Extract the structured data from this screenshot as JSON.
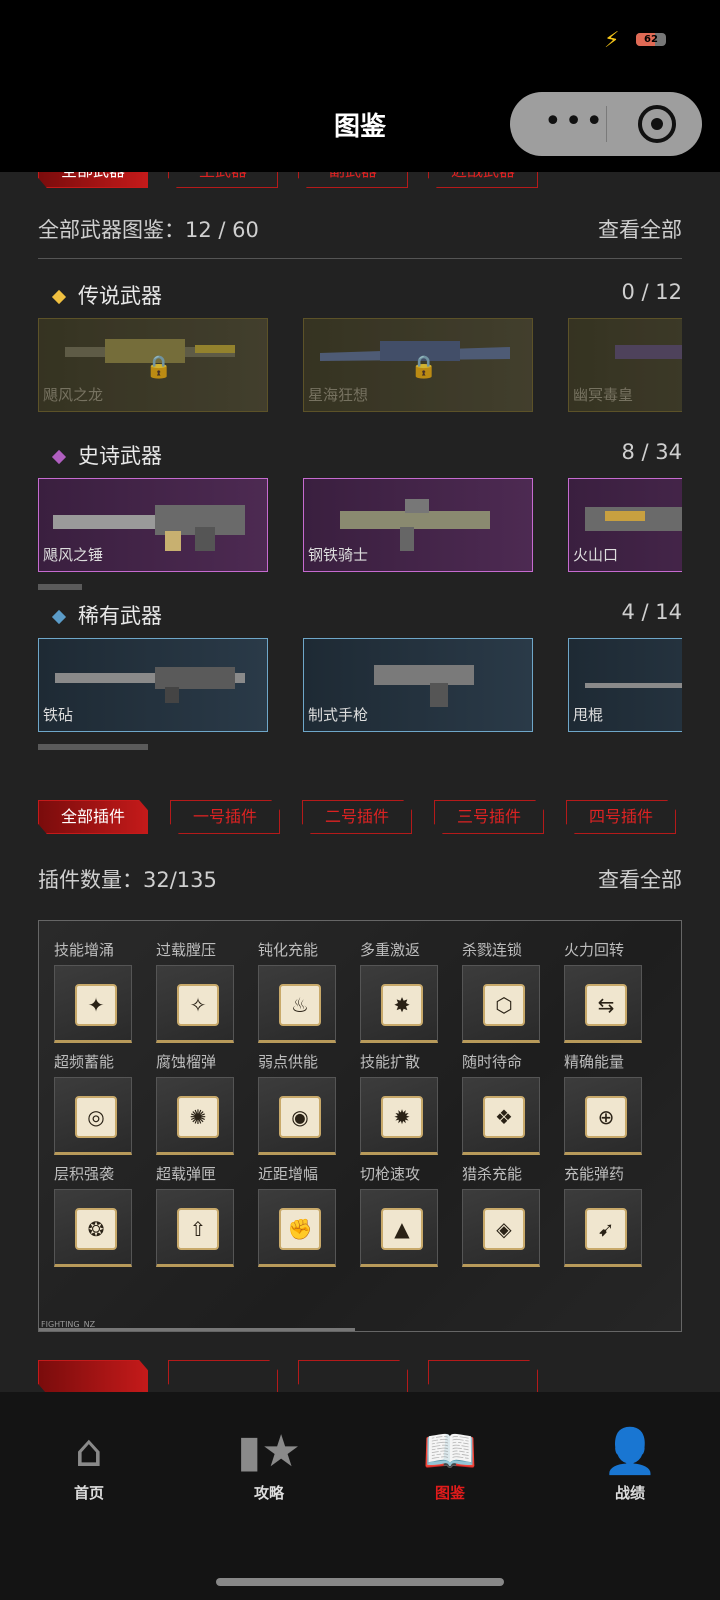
{
  "status": {
    "battery": "62"
  },
  "header": {
    "title": "图鉴"
  },
  "weapon_tabs": [
    "全部武器",
    "主武器",
    "副武器",
    "近战武器"
  ],
  "weapon_summary": {
    "label": "全部武器图鉴：12 / 60",
    "view_all": "查看全部"
  },
  "sections": [
    {
      "title": "传说武器",
      "count": "0 / 12",
      "color": "#f0c040",
      "rarity": "legend",
      "items": [
        "飓风之龙",
        "星海狂想",
        "幽冥毒皇"
      ]
    },
    {
      "title": "史诗武器",
      "count": "8 / 34",
      "color": "#b05fc0",
      "rarity": "epic",
      "items": [
        "飓风之锤",
        "钢铁骑士",
        "火山口"
      ]
    },
    {
      "title": "稀有武器",
      "count": "4 / 14",
      "color": "#5b9cc9",
      "rarity": "rare",
      "items": [
        "铁砧",
        "制式手枪",
        "甩棍"
      ]
    }
  ],
  "plugin_tabs": [
    "全部插件",
    "一号插件",
    "二号插件",
    "三号插件",
    "四号插件"
  ],
  "plugin_summary": {
    "label": "插件数量：32/135",
    "view_all": "查看全部"
  },
  "plugins": [
    "技能增涌",
    "过载膛压",
    "钝化充能",
    "多重激返",
    "杀戮连锁",
    "火力回转",
    "超频蓄能",
    "腐蚀榴弹",
    "弱点供能",
    "技能扩散",
    "随时待命",
    "精确能量",
    "层积强袭",
    "超载弹匣",
    "近距增幅",
    "切枪速攻",
    "猎杀充能",
    "充能弹药"
  ],
  "panel_footer": "FIGHTING_NZ",
  "nav": [
    {
      "label": "首页",
      "icon": "home-icon"
    },
    {
      "label": "攻略",
      "icon": "guide-book-icon"
    },
    {
      "label": "图鉴",
      "icon": "codex-icon",
      "active": true
    },
    {
      "label": "战绩",
      "icon": "user-icon"
    }
  ]
}
